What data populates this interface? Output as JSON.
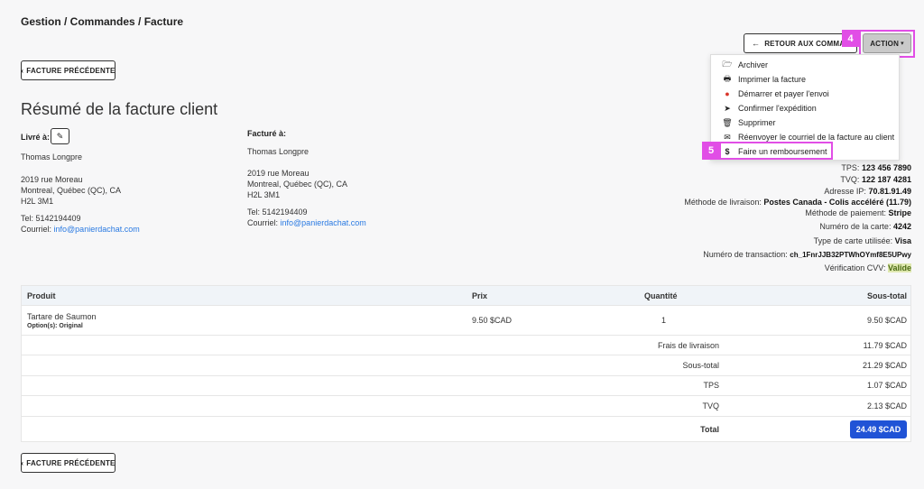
{
  "breadcrumb": "Gestion / Commandes / Facture",
  "buttons": {
    "prev_top": "FACTURE PRÉCÉDENTE",
    "prev_bottom": "FACTURE PRÉCÉDENTE",
    "back": "RETOUR AUX COMMANDES",
    "action": "ACTION"
  },
  "callouts": {
    "action": "4",
    "refund": "5"
  },
  "page_title": "Résumé de la facture client",
  "shipping": {
    "label": "Livré à:",
    "name": "Thomas Longpre",
    "street": "2019 rue Moreau",
    "city": "Montreal, Québec (QC), CA",
    "postal": "H2L 3M1",
    "tel": "Tel: 5142194409",
    "email_label": "Courriel:",
    "email": "info@panierdachat.com"
  },
  "billing": {
    "label": "Facturé à:",
    "name": "Thomas Longpre",
    "street": "2019 rue Moreau",
    "city": "Montreal, Québec (QC), CA",
    "postal": "H2L 3M1",
    "tel": "Tel: 5142194409",
    "email_label": "Courriel:",
    "email": "info@panierdachat.com"
  },
  "menu": [
    {
      "icon": "folder-open-icon",
      "glyph": "🗁",
      "label": "Archiver"
    },
    {
      "icon": "print-icon",
      "glyph": "🖶",
      "label": "Imprimer la facture"
    },
    {
      "icon": "start-pay-icon",
      "glyph": "●",
      "label": "Démarrer et payer l'envoi"
    },
    {
      "icon": "send-icon",
      "glyph": "➤",
      "label": "Confirmer l'expédition"
    },
    {
      "icon": "trash-icon",
      "glyph": "🗑",
      "label": "Supprimer"
    },
    {
      "icon": "envelope-icon",
      "glyph": "✉",
      "label": "Réenvoyer le courriel de la facture au client"
    },
    {
      "icon": "dollar-icon",
      "glyph": "$",
      "label": "Faire un remboursement"
    }
  ],
  "order_info": {
    "tps_label": "TPS:",
    "tps": "123 456 7890",
    "tvq_label": "TVQ:",
    "tvq": "122 187 4281",
    "ip_label": "Adresse IP:",
    "ip": "70.81.91.49",
    "delivery_label": "Méthode de livraison:",
    "delivery": "Postes Canada - Colis accéléré (11.79)",
    "payment_label": "Méthode de paiement:",
    "payment": "Stripe",
    "card_label": "Numéro de la carte:",
    "card": "4242",
    "card_type_label": "Type de carte utilisée:",
    "card_type": "Visa",
    "txn_label": "Numéro de transaction:",
    "txn": "ch_1FnrJJB32PTWhOYmf8E5UPwy",
    "cvv_label": "Vérification CVV:",
    "cvv": "Valide"
  },
  "table": {
    "headers": {
      "product": "Produit",
      "price": "Prix",
      "qty": "Quantité",
      "subtotal": "Sous-total"
    },
    "item": {
      "name": "Tartare de Saumon",
      "options": "Option(s): Original",
      "price": "9.50 $CAD",
      "qty": "1",
      "subtotal": "9.50 $CAD"
    },
    "summary": {
      "shipping_label": "Frais de livraison",
      "shipping": "11.79 $CAD",
      "subtotal_label": "Sous-total",
      "subtotal": "21.29 $CAD",
      "tps_label": "TPS",
      "tps": "1.07 $CAD",
      "tvq_label": "TVQ",
      "tvq": "2.13 $CAD",
      "total_label": "Total",
      "total": "24.49 $CAD"
    }
  },
  "colors": {
    "accent": "#2053d6",
    "callout": "#e14ee6",
    "link": "#2a7ae2"
  }
}
